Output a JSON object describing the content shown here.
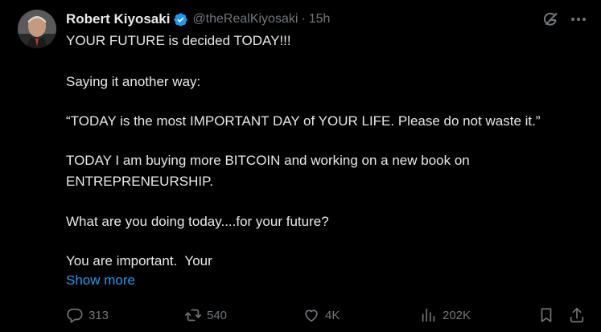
{
  "tweet": {
    "author": {
      "name": "Robert Kiyosaki",
      "handle": "@theRealKiyosaki",
      "separator": "·",
      "time": "15h",
      "verified": true
    },
    "paragraphs": [
      "YOUR FUTURE is decided TODAY!!!",
      "Saying it another way:",
      "“TODAY is the most IMPORTANT DAY of YOUR LIFE. Please do not waste it.”",
      "TODAY I am buying more BITCOIN and working on a new book on\nENTREPRENEURSHIP.",
      "What are you doing today....for your future?",
      "You are important.  Your"
    ],
    "show_more": "Show more",
    "actions": {
      "replies": "313",
      "reposts": "540",
      "likes": "4K",
      "views": "202K"
    },
    "icons": {
      "verified": "verified-badge-icon",
      "grok": "grok-icon",
      "more": "more-dots-icon",
      "reply": "reply-bubble-icon",
      "repost": "repost-icon",
      "like": "heart-icon",
      "views": "views-chart-icon",
      "bookmark": "bookmark-icon",
      "share": "share-icon"
    },
    "colors": {
      "background": "#000000",
      "text": "#e7e9ea",
      "muted": "#71767b",
      "accent": "#1d9bf0"
    }
  }
}
